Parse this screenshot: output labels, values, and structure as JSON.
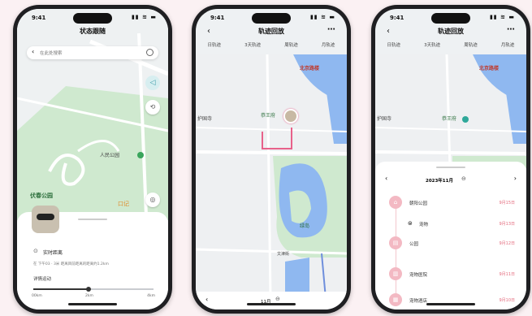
{
  "status": {
    "time": "9:41",
    "icons": "▮▮ ≋ ▬"
  },
  "phone1": {
    "title": "状态跟随",
    "search_placeholder": "在此处搜索",
    "map_labels": {
      "park_main": "伏春公园",
      "park_people": "人民公园",
      "poi": "口记"
    },
    "sheet": {
      "status": "实时距离",
      "detail": "在 下午03 · 3米 距离目前距离的距离约1.2km",
      "link": "详情运动",
      "scale": [
        "00km",
        "2km",
        "4km"
      ]
    }
  },
  "phone2": {
    "title": "轨迹回放",
    "tabs": [
      "日轨迹",
      "3天轨迹",
      "周轨迹",
      "月轨迹"
    ],
    "map_labels": {
      "north": "北京路楼",
      "west": "护国寺",
      "place": "恭王府",
      "island": "绿岛",
      "road": "文津街"
    },
    "bottom": {
      "date": "11月"
    }
  },
  "phone3": {
    "title": "轨迹回放",
    "tabs": [
      "日轨迹",
      "3天轨迹",
      "周轨迹",
      "月轨迹"
    ],
    "map_labels": {
      "north": "北京路楼",
      "west": "护国寺",
      "place": "恭王府"
    },
    "timeline": {
      "month": "2023年11月",
      "entries": [
        {
          "place": "朝阳公园",
          "time": "9月15日"
        },
        {
          "place": "宠物",
          "time": "9月13日"
        },
        {
          "place": "公园",
          "time": "9月12日"
        },
        {
          "place": "宠物医院",
          "time": "9月11日"
        },
        {
          "place": "宠物酒店",
          "time": "9月10日"
        }
      ]
    }
  }
}
